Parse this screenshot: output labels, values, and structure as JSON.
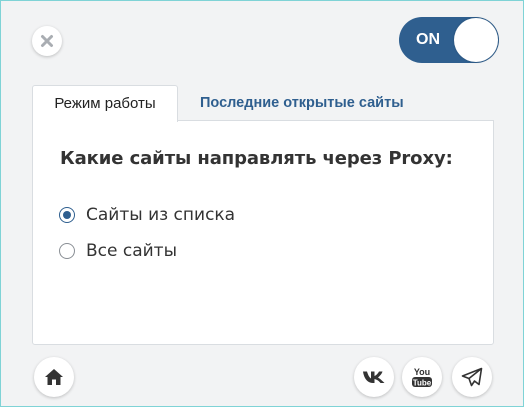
{
  "toggle": {
    "label": "ON",
    "state": "on"
  },
  "tabs": [
    {
      "label": "Режим работы",
      "active": true
    },
    {
      "label": "Последние открытые сайты",
      "active": false
    }
  ],
  "panel": {
    "heading": "Какие сайты направлять через Proxy:",
    "options": [
      {
        "label": "Сайты из списка",
        "checked": true
      },
      {
        "label": "Все сайты",
        "checked": false
      }
    ]
  },
  "footer": {
    "icons": [
      "home-icon",
      "vk-icon",
      "youtube-icon",
      "telegram-icon"
    ],
    "youtube_text_1": "You",
    "youtube_text_2": "Tube"
  },
  "colors": {
    "accent": "#2f5f8f",
    "border": "#7fd3d6",
    "background": "#f2f3f4"
  }
}
